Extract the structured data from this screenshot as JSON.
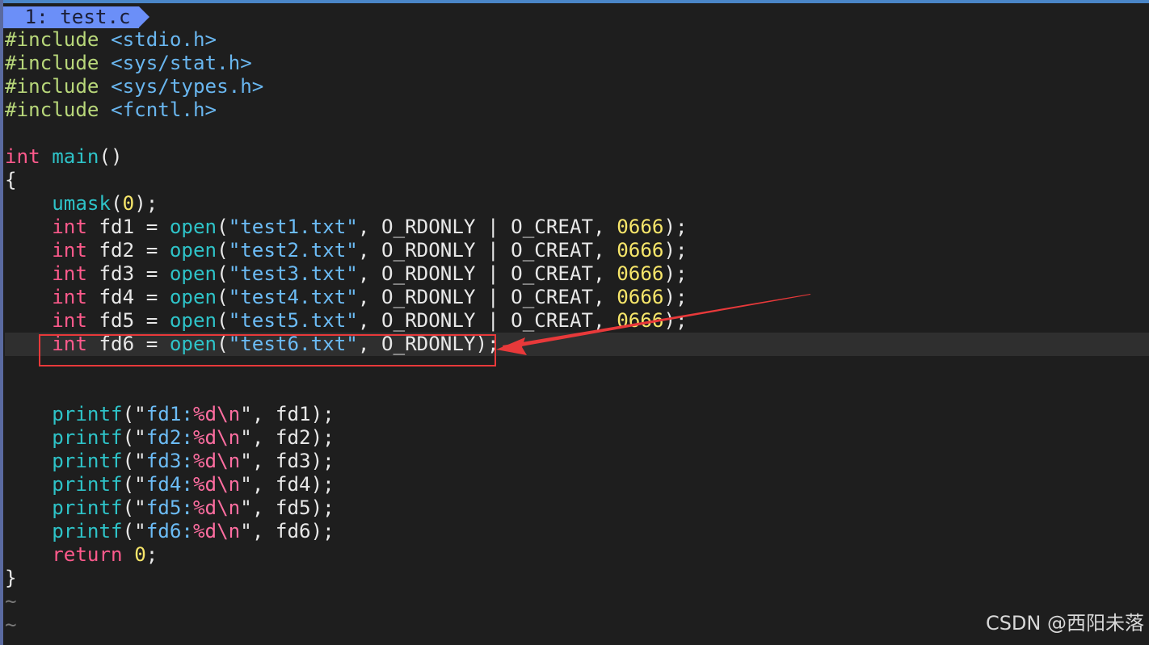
{
  "tabline": {
    "active_tab": " 1: test.c"
  },
  "code": {
    "include1": {
      "directive": "#include",
      "header": "<stdio.h>"
    },
    "include2": {
      "directive": "#include",
      "header": "<sys/stat.h>"
    },
    "include3": {
      "directive": "#include",
      "header": "<sys/types.h>"
    },
    "include4": {
      "directive": "#include",
      "header": "<fcntl.h>"
    },
    "main_sig": {
      "type": "int",
      "name": "main",
      "parens": "()"
    },
    "open_brace": "{",
    "umask": {
      "fn": "umask",
      "open": "(",
      "arg": "0",
      "close": ");"
    },
    "open_calls": [
      {
        "type": "int",
        "lhs": " fd1 = ",
        "fn": "open",
        "str": "\"test1.txt\"",
        "flags": ", O_RDONLY | O_CREAT, ",
        "mode": "0666",
        "end": ");"
      },
      {
        "type": "int",
        "lhs": " fd2 = ",
        "fn": "open",
        "str": "\"test2.txt\"",
        "flags": ", O_RDONLY | O_CREAT, ",
        "mode": "0666",
        "end": ");"
      },
      {
        "type": "int",
        "lhs": " fd3 = ",
        "fn": "open",
        "str": "\"test3.txt\"",
        "flags": ", O_RDONLY | O_CREAT, ",
        "mode": "0666",
        "end": ");"
      },
      {
        "type": "int",
        "lhs": " fd4 = ",
        "fn": "open",
        "str": "\"test4.txt\"",
        "flags": ", O_RDONLY | O_CREAT, ",
        "mode": "0666",
        "end": ");"
      },
      {
        "type": "int",
        "lhs": " fd5 = ",
        "fn": "open",
        "str": "\"test5.txt\"",
        "flags": ", O_RDONLY | O_CREAT, ",
        "mode": "0666",
        "end": ");"
      }
    ],
    "open6": {
      "type": "int",
      "lhs": " fd6 = ",
      "fn": "open",
      "str": "\"test6.txt\"",
      "flags": ", O_RDONLY);"
    },
    "printf_calls": [
      {
        "fn": "printf",
        "q1": "(\"",
        "text": "fd1:",
        "fmt": "%d\\n",
        "q2": "\"",
        "rest": ", fd1);"
      },
      {
        "fn": "printf",
        "q1": "(\"",
        "text": "fd2:",
        "fmt": "%d\\n",
        "q2": "\"",
        "rest": ", fd2);"
      },
      {
        "fn": "printf",
        "q1": "(\"",
        "text": "fd3:",
        "fmt": "%d\\n",
        "q2": "\"",
        "rest": ", fd3);"
      },
      {
        "fn": "printf",
        "q1": "(\"",
        "text": "fd4:",
        "fmt": "%d\\n",
        "q2": "\"",
        "rest": ", fd4);"
      },
      {
        "fn": "printf",
        "q1": "(\"",
        "text": "fd5:",
        "fmt": "%d\\n",
        "q2": "\"",
        "rest": ", fd5);"
      },
      {
        "fn": "printf",
        "q1": "(\"",
        "text": "fd6:",
        "fmt": "%d\\n",
        "q2": "\"",
        "rest": ", fd6);"
      }
    ],
    "return_stmt": {
      "kw": "return",
      "val": "0",
      "end": ";"
    },
    "close_brace": "}",
    "tilde": "~"
  },
  "watermark": "CSDN @西阳未落",
  "colors": {
    "background": "#1e1e1e",
    "tab_active": "#6b8ff8",
    "annotation": "#e8393a"
  }
}
